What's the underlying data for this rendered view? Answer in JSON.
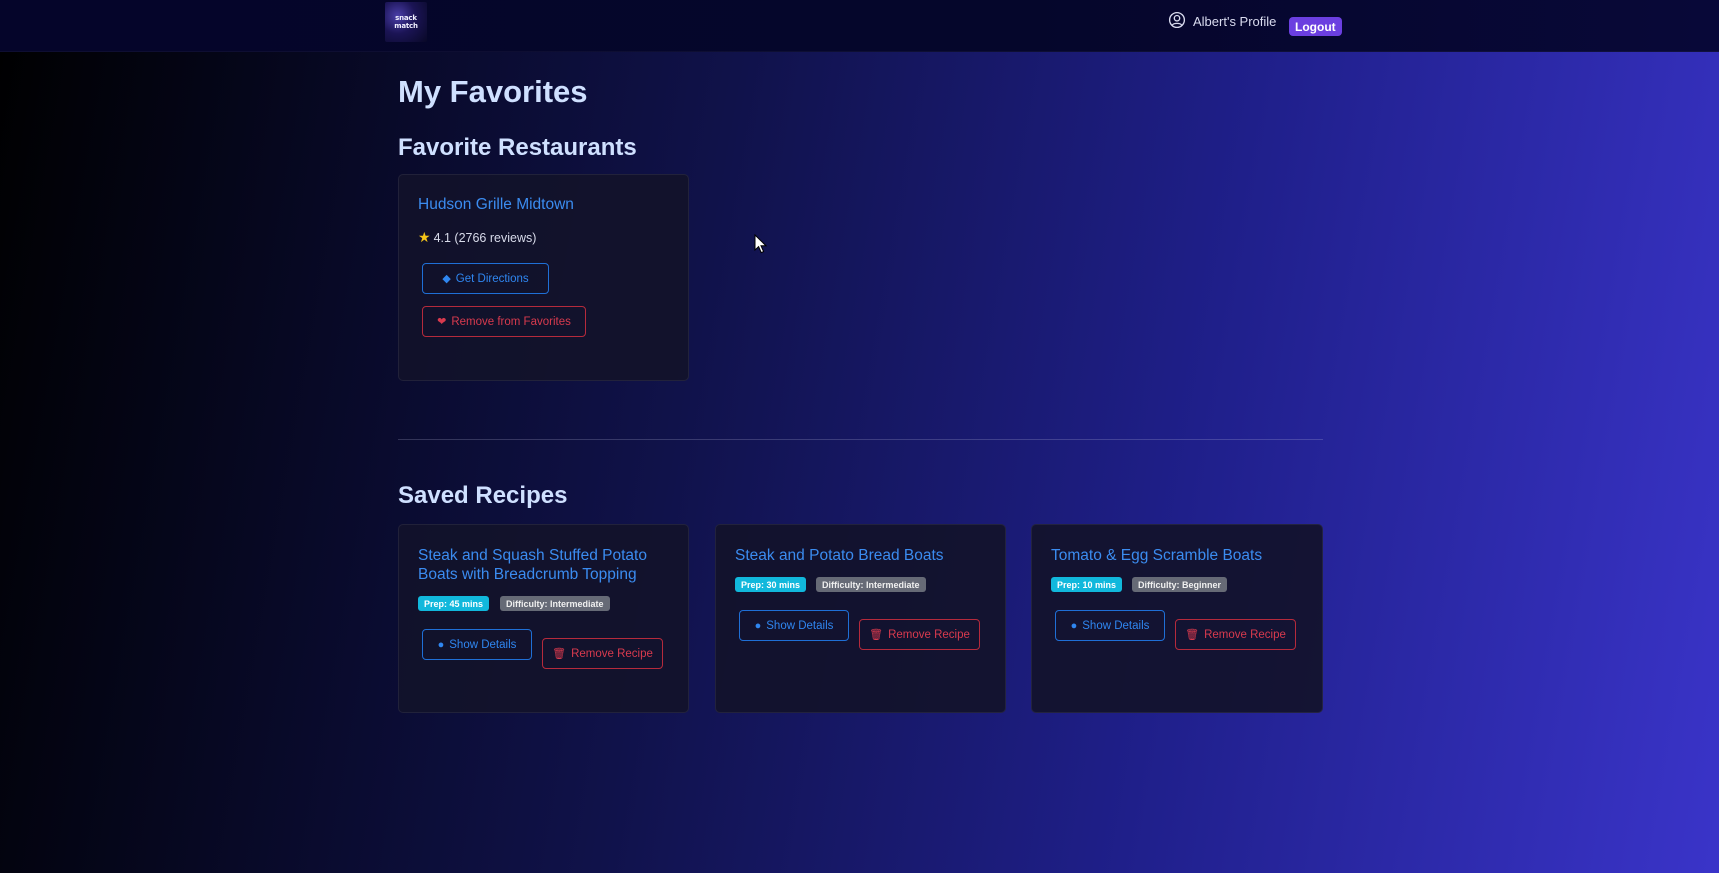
{
  "header": {
    "logo_text_line1": "snack",
    "logo_text_line2": "match",
    "profile_label": "Albert's Profile",
    "logout_label": "Logout"
  },
  "page": {
    "title": "My Favorites"
  },
  "restaurants": {
    "heading": "Favorite Restaurants",
    "items": [
      {
        "name": "Hudson Grille Midtown",
        "rating": "4.1 (2766 reviews)",
        "directions_label": "Get Directions",
        "remove_label": "Remove from Favorites"
      }
    ]
  },
  "recipes": {
    "heading": "Saved Recipes",
    "items": [
      {
        "title": "Steak and Squash Stuffed Potato Boats with Breadcrumb Topping",
        "prep": "Prep: 45 mins",
        "difficulty": "Difficulty: Intermediate",
        "details_label": "Show Details",
        "remove_label": "Remove Recipe"
      },
      {
        "title": "Steak and Potato Bread Boats",
        "prep": "Prep: 30 mins",
        "difficulty": "Difficulty: Intermediate",
        "details_label": "Show Details",
        "remove_label": "Remove Recipe"
      },
      {
        "title": "Tomato & Egg Scramble Boats",
        "prep": "Prep: 10 mins",
        "difficulty": "Difficulty: Beginner",
        "details_label": "Show Details",
        "remove_label": "Remove Recipe"
      }
    ]
  },
  "icons": {
    "profile": "user-circle-icon",
    "star": "star-icon",
    "directions": "directions-icon",
    "heart": "heart-icon",
    "info": "info-circle-icon",
    "trash": "trash-icon",
    "cursor": "mouse-cursor-icon"
  },
  "colors": {
    "accent_blue": "#2f86f0",
    "danger_red": "#d83a4e",
    "logout_purple": "#6b3fe0",
    "prep_badge": "#11b8dc",
    "difficulty_badge": "#666a76"
  }
}
